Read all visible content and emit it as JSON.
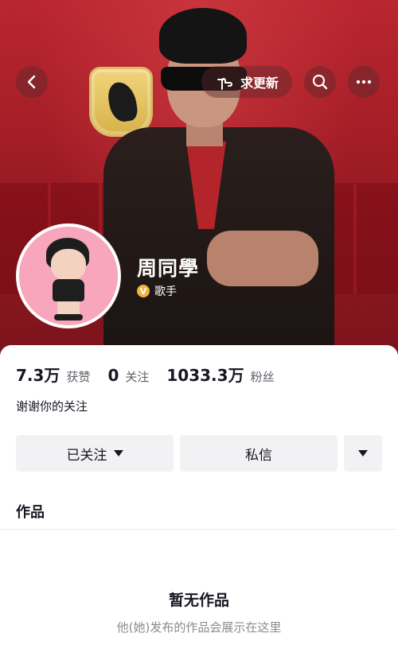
{
  "header": {
    "update_label": "求更新",
    "icons": {
      "back": "chevron-left-icon",
      "update": "pointing-hand-icon",
      "search": "search-icon",
      "more": "more-icon"
    }
  },
  "profile": {
    "name": "周同學",
    "verified_badge": "V",
    "verified_title": "歌手",
    "bio": "谢谢你的关注"
  },
  "stats": [
    {
      "value": "7.3万",
      "label": "获赞"
    },
    {
      "value": "0",
      "label": "关注"
    },
    {
      "value": "1033.3万",
      "label": "粉丝"
    }
  ],
  "actions": {
    "following_label": "已关注",
    "message_label": "私信"
  },
  "tabs": {
    "works_label": "作品"
  },
  "empty_state": {
    "title": "暂无作品",
    "subtitle": "他(她)发布的作品会展示在这里"
  },
  "colors": {
    "cover": "#a61e27",
    "verified": "#f3b43a",
    "button_bg": "#f2f2f4"
  }
}
